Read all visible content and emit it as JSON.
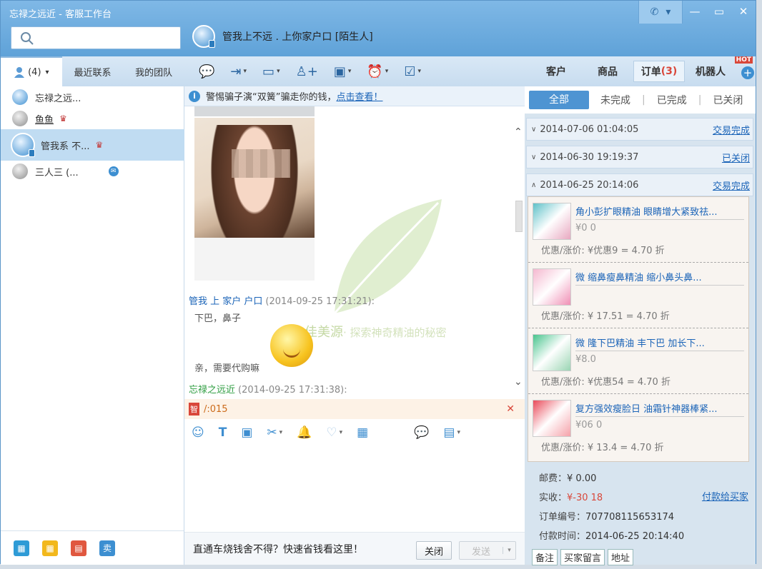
{
  "window": {
    "title": "忘禄之远近 - 客服工作台"
  },
  "controls": {
    "phone": "✆",
    "phone_caret": "▾",
    "minimize": "—",
    "maximize": "▭",
    "close": "✕"
  },
  "search": {
    "placeholder": ""
  },
  "chat_header": {
    "name": "管我上不远 . 上你家户口 [陌生人]"
  },
  "sidebar": {
    "tabs": [
      {
        "label": "(4)",
        "caret": "▾"
      },
      {
        "label": "最近联系"
      },
      {
        "label": "我的团队"
      }
    ],
    "contacts": [
      {
        "name": "忘禄之远..."
      },
      {
        "name": "鱼鱼"
      },
      {
        "name": "管我系 不..."
      },
      {
        "name": "三人三 (..."
      }
    ]
  },
  "notice": {
    "text": "警惕骗子演“双簧”骗走你的钱，",
    "link": "点击查看！"
  },
  "messages": [
    {
      "sender": "管我 上 家户 户口",
      "time": "(2014-09-25 17:31:21):",
      "body": "下巴，鼻子"
    },
    {
      "sender": "",
      "time": "",
      "body": "亲，需要代购嘛"
    },
    {
      "sender": "忘禄之远近",
      "time": "(2014-09-25 17:31:38):",
      "body": ""
    }
  ],
  "watermark": {
    "brand": "佳美源",
    "slogan": "· 探索神奇精油的秘密"
  },
  "quote": {
    "tag": "智",
    "text": "/:015",
    "close": "✕"
  },
  "footer": {
    "ad": "直通车烧钱舍不得？快速省钱看这里！",
    "close_label": "关闭",
    "send_label": "发送",
    "send_caret": "▾"
  },
  "right": {
    "tabs": [
      {
        "label": "客户"
      },
      {
        "label": "商品"
      },
      {
        "label": "订单",
        "count": "(3)"
      },
      {
        "label": "机器人"
      }
    ],
    "hot": "HOT",
    "plus": "+",
    "filters": [
      "全部",
      "未完成",
      "已完成",
      "已关闭"
    ],
    "orders": [
      {
        "date": "2014-07-06 01:04:05",
        "status": "交易完成",
        "caret": "∨"
      },
      {
        "date": "2014-06-30 19:19:37",
        "status": "已关闭",
        "caret": "∨"
      },
      {
        "date": "2014-06-25 20:14:06",
        "status": "交易完成",
        "caret": "∧"
      }
    ],
    "items": [
      {
        "name": "角小彭扩眼精油 眼睛增大紧致祛...",
        "price": "¥0 0",
        "disc": "优惠/涨价: ¥优惠9 = 4.70 折"
      },
      {
        "name": "微 缩鼻瘦鼻精油 缩小鼻头鼻...",
        "price": "",
        "disc": "优惠/涨价: ¥ 17.51 = 4.70 折"
      },
      {
        "name": "微 隆下巴精油 丰下巴 加长下...",
        "price": "¥8.0",
        "disc": "优惠/涨价: ¥优惠54 = 4.70 折"
      },
      {
        "name": "复方强效瘦脸日 油霜针神器棒紧...",
        "price": "¥06 0",
        "disc": "优惠/涨价: ¥ 13.4 = 4.70 折"
      }
    ],
    "summary": {
      "shipping_label": "邮费：",
      "shipping": "¥ 0.00",
      "paid_label": "实收：",
      "paid": "¥-30 18",
      "order_no_label": "订单编号：",
      "order_no": "707708115653174",
      "pay_time_label": "付款时间：",
      "pay_time": "2014-06-25 20:14:40",
      "pay_link": "付款给买家"
    },
    "bottom_buttons": [
      "备注",
      "买家留言",
      "地址"
    ]
  }
}
